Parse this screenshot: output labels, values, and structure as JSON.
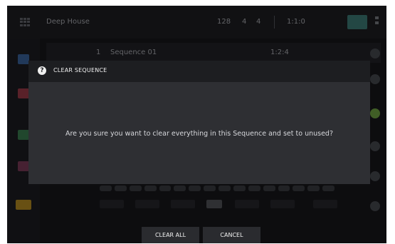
{
  "header": {
    "project_name": "Deep House",
    "bpm": "128",
    "time_signature": "4",
    "sequence_number": "4",
    "position": "1:1:0"
  },
  "track": {
    "number": "1",
    "name": "Sequence 01",
    "bars": "1:2:4"
  },
  "dialog": {
    "title": "CLEAR SEQUENCE",
    "help_icon": "?",
    "message": "Are you sure you want to clear everything in this Sequence and set to unused?"
  },
  "buttons": {
    "clear_all": "CLEAR ALL",
    "cancel": "CANCEL"
  },
  "colors": {
    "dialog_bg": "#2e2f33",
    "dialog_header_bg": "#1d1e21",
    "screen_bg": "#0d0d0f",
    "accent_teal": "#3f8f86",
    "play_green": "#7ec043"
  }
}
